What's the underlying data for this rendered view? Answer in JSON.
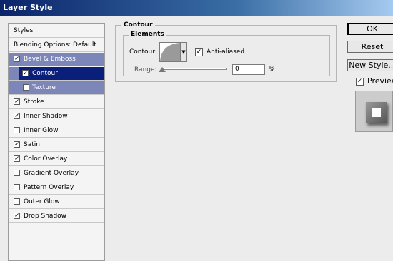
{
  "window": {
    "title": "Layer Style"
  },
  "stylelist": {
    "header": "Styles",
    "items": [
      {
        "label": "Blending Options: Default",
        "checkbox": false,
        "checked": false,
        "state": "normal"
      },
      {
        "label": "Bevel & Emboss",
        "checkbox": true,
        "checked": true,
        "state": "parent-selected"
      },
      {
        "label": "Contour",
        "checkbox": true,
        "checked": true,
        "state": "selected",
        "sub": true
      },
      {
        "label": "Texture",
        "checkbox": true,
        "checked": false,
        "state": "parent-selected",
        "sub": true
      },
      {
        "label": "Stroke",
        "checkbox": true,
        "checked": true,
        "state": "normal"
      },
      {
        "label": "Inner Shadow",
        "checkbox": true,
        "checked": true,
        "state": "normal"
      },
      {
        "label": "Inner Glow",
        "checkbox": true,
        "checked": false,
        "state": "normal"
      },
      {
        "label": "Satin",
        "checkbox": true,
        "checked": true,
        "state": "normal"
      },
      {
        "label": "Color Overlay",
        "checkbox": true,
        "checked": true,
        "state": "normal"
      },
      {
        "label": "Gradient Overlay",
        "checkbox": true,
        "checked": false,
        "state": "normal"
      },
      {
        "label": "Pattern Overlay",
        "checkbox": true,
        "checked": false,
        "state": "normal"
      },
      {
        "label": "Outer Glow",
        "checkbox": true,
        "checked": false,
        "state": "normal"
      },
      {
        "label": "Drop Shadow",
        "checkbox": true,
        "checked": true,
        "state": "normal"
      }
    ]
  },
  "contour_panel": {
    "group_title": "Contour",
    "subgroup_title": "Elements",
    "contour_label": "Contour:",
    "anti_aliased_label": "Anti-aliased",
    "anti_aliased_checked": true,
    "range_label": "Range:",
    "range_value": "0",
    "range_unit": "%"
  },
  "buttons": {
    "ok": "OK",
    "reset": "Reset",
    "new_style": "New Style..."
  },
  "preview": {
    "label": "Preview",
    "checked": true
  },
  "colors": {
    "selected": "#0a1f7a",
    "parent_selected": "#7c86b8",
    "titlebar_start": "#0a246a"
  }
}
